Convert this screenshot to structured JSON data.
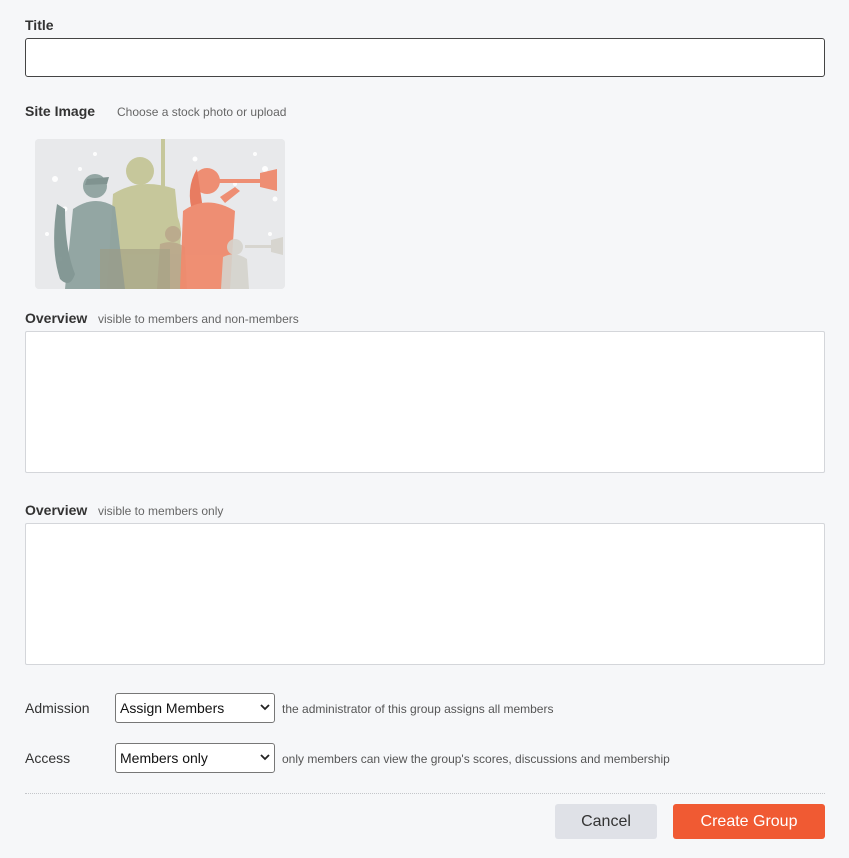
{
  "form": {
    "title_label": "Title",
    "title_value": "",
    "site_image_label": "Site Image",
    "site_image_hint": "Choose a stock photo or upload",
    "overview_public_label": "Overview",
    "overview_public_hint": "visible to members and non-members",
    "overview_private_label": "Overview",
    "overview_private_hint": "visible to members only",
    "admission": {
      "label": "Admission",
      "selected": "Assign Members",
      "description": "the administrator of this group assigns all members"
    },
    "access": {
      "label": "Access",
      "selected": "Members only",
      "description": "only members can view the group's scores, discussions and membership"
    }
  },
  "buttons": {
    "cancel": "Cancel",
    "create": "Create Group"
  },
  "colors": {
    "accent": "#f05a33",
    "cancel_bg": "#dfe1e7",
    "page_bg": "#f6f7f9"
  },
  "icons": {
    "select_arrow": "chevron-down-icon"
  }
}
